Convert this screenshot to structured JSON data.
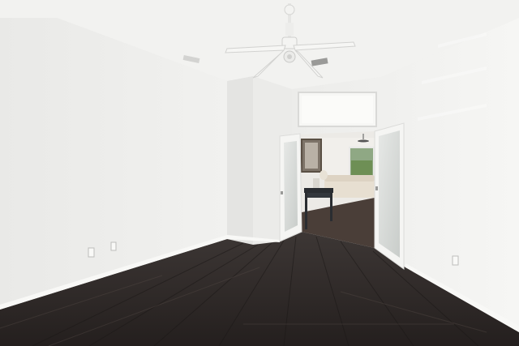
{
  "scene": {
    "subject": "empty-room-interior",
    "colors": {
      "ceiling": "#f1f1ef",
      "wall_left": "#ededeb",
      "wall_center": "#e6e6e4",
      "wall_right": "#f4f4f2",
      "floor_dark": "#2f2a29",
      "floor_mid": "#3d3735",
      "baseboard": "#f8f8f6",
      "door_frame": "#f5f5f3",
      "glass": "#d7dad8",
      "window_green": "#6e8f55",
      "sofa": "#e7dfd1",
      "console": "#2a2d31"
    },
    "objects": [
      {
        "name": "ceiling-fan",
        "icon": "ceiling-fan-icon"
      },
      {
        "name": "french-door-left",
        "icon": "door-icon"
      },
      {
        "name": "french-door-right",
        "icon": "door-icon"
      },
      {
        "name": "transom-window",
        "icon": "window-icon"
      },
      {
        "name": "console-table",
        "icon": "table-icon"
      },
      {
        "name": "wall-art",
        "icon": "picture-frame-icon"
      },
      {
        "name": "sofa",
        "icon": "sofa-icon"
      },
      {
        "name": "wall-outlet",
        "icon": "outlet-icon"
      },
      {
        "name": "ceiling-vent",
        "icon": "vent-icon"
      }
    ]
  }
}
